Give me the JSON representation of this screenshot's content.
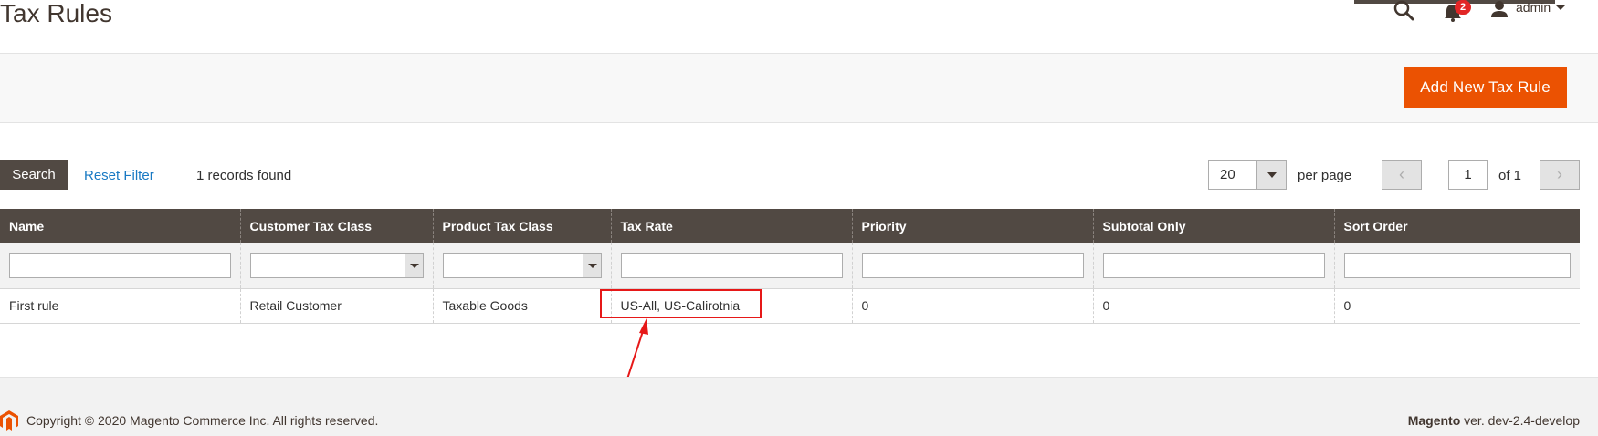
{
  "page": {
    "title": "Tax Rules"
  },
  "header": {
    "notifications_count": "2",
    "user_name": "admin"
  },
  "actions": {
    "add_button": "Add New Tax Rule"
  },
  "toolbar": {
    "search_label": "Search",
    "reset_filter_label": "Reset Filter",
    "records_found": "1 records found",
    "per_page_value": "20",
    "per_page_label": "per page",
    "current_page": "1",
    "page_of": "of 1"
  },
  "grid": {
    "columns": [
      "Name",
      "Customer Tax Class",
      "Product Tax Class",
      "Tax Rate",
      "Priority",
      "Subtotal Only",
      "Sort Order"
    ],
    "rows": [
      {
        "name": "First rule",
        "customer_tax_class": "Retail Customer",
        "product_tax_class": "Taxable Goods",
        "tax_rate": "US-All, US-Calirotnia",
        "priority": "0",
        "subtotal_only": "0",
        "sort_order": "0"
      }
    ]
  },
  "annotation": {
    "color": "#e61818"
  },
  "footer": {
    "copyright": "Copyright © 2020 Magento Commerce Inc. All rights reserved.",
    "brand": "Magento",
    "version": " ver. dev-2.4-develop"
  },
  "colors": {
    "accent": "#eb5202",
    "header_dark": "#514943",
    "link": "#1979c3"
  },
  "icons": [
    "search-icon",
    "bell-icon",
    "user-icon",
    "chevron-left-icon",
    "chevron-right-icon",
    "magento-logo-icon"
  ]
}
